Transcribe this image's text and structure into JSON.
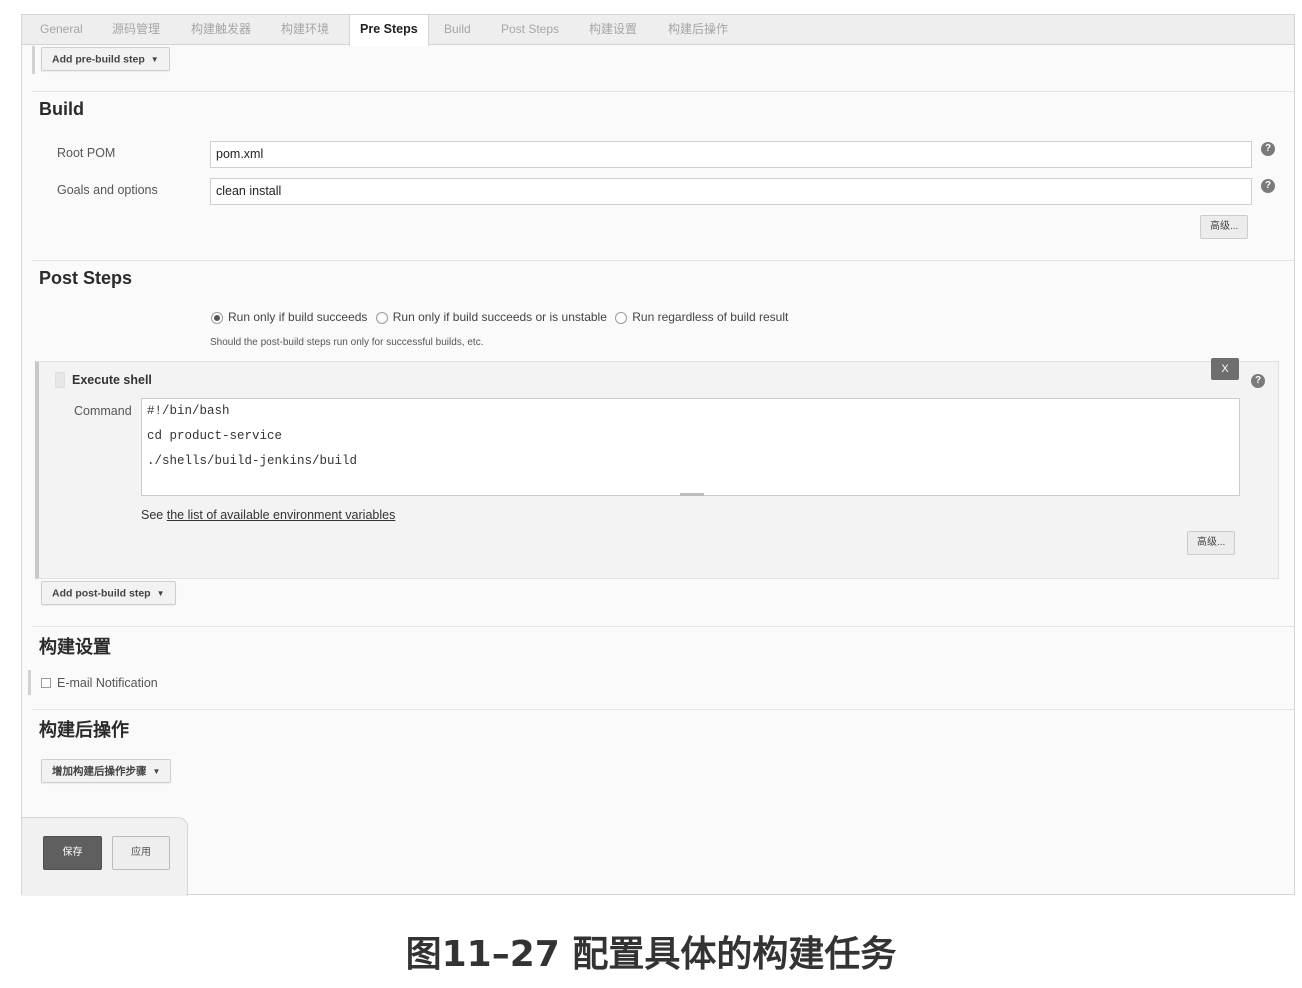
{
  "tabs": [
    {
      "label": "General"
    },
    {
      "label": "源码管理"
    },
    {
      "label": "构建触发器"
    },
    {
      "label": "构建环境"
    },
    {
      "label": "Pre Steps",
      "active": true
    },
    {
      "label": "Build"
    },
    {
      "label": "Post Steps"
    },
    {
      "label": "构建设置"
    },
    {
      "label": "构建后操作"
    }
  ],
  "pre_steps": {
    "add_button": "Add pre-build step"
  },
  "build": {
    "title": "Build",
    "root_pom_label": "Root POM",
    "root_pom_value": "pom.xml",
    "goals_label": "Goals and options",
    "goals_value": "clean install",
    "advanced_button": "高级..."
  },
  "post_steps": {
    "title": "Post Steps",
    "radio_options": [
      {
        "label": "Run only if build succeeds",
        "checked": true
      },
      {
        "label": "Run only if build succeeds or is unstable",
        "checked": false
      },
      {
        "label": "Run regardless of build result",
        "checked": false
      }
    ],
    "hint": "Should the post-build steps run only for successful builds, etc.",
    "execute_shell": {
      "title": "Execute shell",
      "close_label": "X",
      "command_label": "Command",
      "command_lines": [
        "#!/bin/bash",
        "cd product-service",
        "./shells/build-jenkins/build"
      ],
      "see_prefix": "See",
      "see_link": "the list of available environment variables",
      "advanced_button": "高级..."
    },
    "add_button": "Add post-build step"
  },
  "build_settings": {
    "title": "构建设置",
    "email_label": "E-mail Notification"
  },
  "post_build": {
    "title": "构建后操作",
    "add_button": "增加构建后操作步骤"
  },
  "footer": {
    "save": "保存",
    "apply": "应用"
  },
  "caption": "图11–27 配置具体的构建任务",
  "icons": {
    "help": "help-icon",
    "caret": "caret-down-icon",
    "close": "close-icon"
  }
}
